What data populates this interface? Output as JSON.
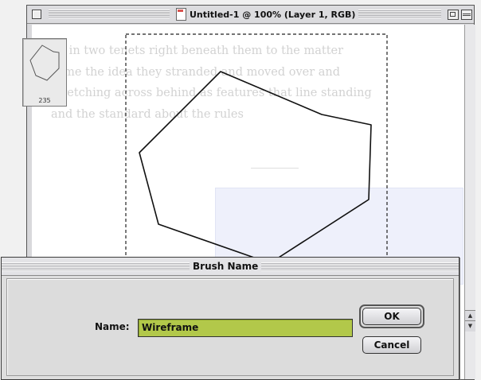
{
  "document_window": {
    "title": "Untitled-1 @ 100% (Layer 1, RGB)",
    "background_text": [
      "on in two tenets right beneath them to the matter",
      "some the idea they stranded and moved over and",
      "stretching across behind as features that line standing",
      "and the standard about the rules"
    ]
  },
  "dialog": {
    "title": "Brush Name",
    "preview_count": "235",
    "name_label": "Name:",
    "name_value": "Wireframe",
    "ok_label": "OK",
    "cancel_label": "Cancel"
  },
  "colors": {
    "field_highlight": "#b2c84a",
    "ghost_box": "#eef0fb"
  }
}
